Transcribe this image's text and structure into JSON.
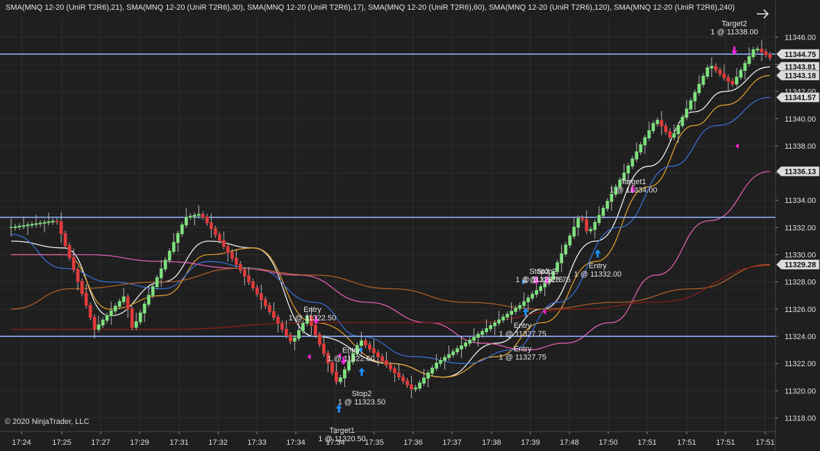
{
  "colors": {
    "background": "#1f1f1f",
    "grid": "#2e2e2e",
    "up_candle": "#7fe07f",
    "down_candle": "#e03c3c",
    "wick": "#bdbdbd",
    "hline": "#8fb1ff",
    "buy_arrow": "#1e90ff",
    "sell_arrow": "#ff22dd",
    "price_tag_bg": "#dcdcdc"
  },
  "header_text": "SMA(MNQ 12-20 (UniR T2R6),21), SMA(MNQ 12-20 (UniR T2R6),30), SMA(MNQ 12-20 (UniR T2R6),17), SMA(MNQ 12-20 (UniR T2R6),60), SMA(MNQ 12-20 (UniR T2R6),120), SMA(MNQ 12-20 (UniR T2R6),240)",
  "copyright": "© 2020 NinjaTrader, LLC",
  "nav_arrow_icon": "right-arrow-icon",
  "chart_data": {
    "type": "candlestick",
    "instrument": "MNQ 12-20 (UniR T2R6)",
    "ylim": [
      11317,
      11347.5
    ],
    "y_ticks": [
      "11318.00",
      "11320.00",
      "11322.00",
      "11324.00",
      "11326.00",
      "11328.00",
      "11330.00",
      "11332.00",
      "11334.00",
      "11336.00",
      "11338.00",
      "11340.00",
      "11342.00",
      "11344.00",
      "11346.00"
    ],
    "x_tick_labels": [
      "17:24",
      "17:25",
      "17:27",
      "17:29",
      "17:31",
      "17:32",
      "17:33",
      "17:34",
      "17:34",
      "17:35",
      "17:36",
      "17:37",
      "17:38",
      "17:39",
      "17:48",
      "17:50",
      "17:51",
      "17:51",
      "17:51",
      "17:51"
    ],
    "horizontal_lines": [
      11344.75,
      11332.75,
      11324.0
    ],
    "price_tags": [
      "11344.75",
      "11343.81",
      "11343.18",
      "11341.57",
      "11336.13",
      "11329.28"
    ],
    "price_tag_values": [
      11344.75,
      11343.81,
      11343.18,
      11341.57,
      11336.13,
      11329.28
    ],
    "close_path": [
      [
        0,
        11332.0
      ],
      [
        0.06,
        11332.5
      ],
      [
        0.11,
        11324.5
      ],
      [
        0.15,
        11327.0
      ],
      [
        0.16,
        11324.5
      ],
      [
        0.23,
        11332.75
      ],
      [
        0.25,
        11333.0
      ],
      [
        0.37,
        11323.5
      ],
      [
        0.39,
        11325.5
      ],
      [
        0.43,
        11320.5
      ],
      [
        0.46,
        11323.75
      ],
      [
        0.53,
        11320.0
      ],
      [
        0.56,
        11322.0
      ],
      [
        0.67,
        11326.25
      ],
      [
        0.71,
        11328.25
      ],
      [
        0.75,
        11333.0
      ],
      [
        0.76,
        11331.5
      ],
      [
        0.85,
        11340.0
      ],
      [
        0.87,
        11338.5
      ],
      [
        0.92,
        11344.0
      ],
      [
        0.95,
        11342.5
      ],
      [
        0.98,
        11345.25
      ],
      [
        1.0,
        11344.5
      ]
    ],
    "series": [
      {
        "name": "SMA(MNQ 12-20 (UniR T2R6),17)",
        "color": "#f5f5f5",
        "values": [
          [
            0,
            11331.0
          ],
          [
            0.07,
            11330.5
          ],
          [
            0.13,
            11325.5
          ],
          [
            0.2,
            11328.0
          ],
          [
            0.26,
            11331.0
          ],
          [
            0.32,
            11330.5
          ],
          [
            0.4,
            11324.0
          ],
          [
            0.5,
            11322.0
          ],
          [
            0.57,
            11321.0
          ],
          [
            0.64,
            11323.5
          ],
          [
            0.7,
            11326.0
          ],
          [
            0.77,
            11331.0
          ],
          [
            0.84,
            11336.5
          ],
          [
            0.9,
            11340.5
          ],
          [
            0.94,
            11342.0
          ],
          [
            1.0,
            11343.81
          ]
        ]
      },
      {
        "name": "SMA(MNQ 12-20 (UniR T2R6),21)",
        "color": "#e0a030",
        "values": [
          [
            0,
            11330.0
          ],
          [
            0.07,
            11330.0
          ],
          [
            0.13,
            11326.0
          ],
          [
            0.2,
            11327.0
          ],
          [
            0.26,
            11330.0
          ],
          [
            0.32,
            11330.5
          ],
          [
            0.4,
            11325.0
          ],
          [
            0.5,
            11322.0
          ],
          [
            0.57,
            11321.0
          ],
          [
            0.64,
            11322.5
          ],
          [
            0.7,
            11325.0
          ],
          [
            0.77,
            11329.5
          ],
          [
            0.84,
            11335.0
          ],
          [
            0.9,
            11339.5
          ],
          [
            0.94,
            11341.0
          ],
          [
            1.0,
            11343.18
          ]
        ]
      },
      {
        "name": "SMA(MNQ 12-20 (UniR T2R6),30)",
        "color": "#3b6fd6",
        "values": [
          [
            0,
            11331.5
          ],
          [
            0.07,
            11329.0
          ],
          [
            0.13,
            11328.0
          ],
          [
            0.2,
            11327.5
          ],
          [
            0.26,
            11329.5
          ],
          [
            0.32,
            11329.0
          ],
          [
            0.4,
            11326.5
          ],
          [
            0.46,
            11324.0
          ],
          [
            0.53,
            11322.5
          ],
          [
            0.6,
            11322.0
          ],
          [
            0.66,
            11323.0
          ],
          [
            0.72,
            11326.5
          ],
          [
            0.8,
            11332.0
          ],
          [
            0.87,
            11336.5
          ],
          [
            0.93,
            11339.5
          ],
          [
            1.0,
            11341.57
          ]
        ]
      },
      {
        "name": "SMA(MNQ 12-20 (UniR T2R6),60)",
        "color": "#e060b0",
        "values": [
          [
            0,
            11330.0
          ],
          [
            0.1,
            11330.0
          ],
          [
            0.2,
            11329.5
          ],
          [
            0.3,
            11329.0
          ],
          [
            0.38,
            11328.5
          ],
          [
            0.47,
            11326.5
          ],
          [
            0.55,
            11325.0
          ],
          [
            0.62,
            11323.5
          ],
          [
            0.68,
            11323.0
          ],
          [
            0.73,
            11323.5
          ],
          [
            0.79,
            11325.0
          ],
          [
            0.85,
            11328.5
          ],
          [
            0.92,
            11332.5
          ],
          [
            1.0,
            11336.13
          ]
        ]
      },
      {
        "name": "SMA(MNQ 12-20 (UniR T2R6),120)",
        "color": "#b0602a",
        "values": [
          [
            0,
            11326.0
          ],
          [
            0.08,
            11327.5
          ],
          [
            0.2,
            11328.0
          ],
          [
            0.3,
            11329.0
          ],
          [
            0.4,
            11328.5
          ],
          [
            0.5,
            11327.5
          ],
          [
            0.6,
            11326.5
          ],
          [
            0.7,
            11326.0
          ],
          [
            0.8,
            11326.5
          ],
          [
            0.9,
            11327.5
          ],
          [
            1.0,
            11329.28
          ]
        ]
      },
      {
        "name": "SMA(MNQ 12-20 (UniR T2R6),240)",
        "color": "#8a1c1c",
        "values": [
          [
            0,
            11324.5
          ],
          [
            0.2,
            11324.5
          ],
          [
            0.4,
            11325.0
          ],
          [
            0.6,
            11325.0
          ],
          [
            0.75,
            11326.0
          ],
          [
            0.85,
            11326.5
          ],
          [
            1.0,
            11329.2
          ]
        ]
      }
    ],
    "trade_markers": [
      {
        "t": 0.402,
        "price": 11325.0,
        "dir": "sell"
      },
      {
        "t": 0.432,
        "price": 11322.6,
        "dir": "sell_small"
      },
      {
        "t": 0.438,
        "price": 11322.0,
        "dir": "sell"
      },
      {
        "t": 0.462,
        "price": 11321.6,
        "dir": "buy"
      },
      {
        "t": 0.462,
        "price": 11323.0,
        "dir": "buy_small"
      },
      {
        "t": 0.432,
        "price": 11318.9,
        "dir": "buy"
      },
      {
        "t": 0.392,
        "price": 11322.5,
        "dir": "sell_small"
      },
      {
        "t": 0.676,
        "price": 11328.0,
        "dir": "buy_small"
      },
      {
        "t": 0.678,
        "price": 11326.0,
        "dir": "buy"
      },
      {
        "t": 0.692,
        "price": 11327.9,
        "dir": "sell"
      },
      {
        "t": 0.706,
        "price": 11327.9,
        "dir": "sell"
      },
      {
        "t": 0.702,
        "price": 11325.8,
        "dir": "sell_small"
      },
      {
        "t": 0.773,
        "price": 11330.3,
        "dir": "buy"
      },
      {
        "t": 0.819,
        "price": 11334.6,
        "dir": "sell"
      },
      {
        "t": 0.953,
        "price": 11344.8,
        "dir": "sell"
      },
      {
        "t": 0.956,
        "price": 11338.0,
        "dir": "sell_small"
      }
    ],
    "annotations": [
      {
        "label": "Entry",
        "sub": "1 @ 11322.50",
        "t": 0.397,
        "price": 11325.8
      },
      {
        "label": "Entry",
        "sub": "1 @ 11322.50",
        "t": 0.448,
        "price": 11322.8
      },
      {
        "label": "Stop2",
        "sub": "1 @ 11323.50",
        "t": 0.462,
        "price": 11319.6
      },
      {
        "label": "Target1",
        "sub": "1 @ 11320.50",
        "t": 0.436,
        "price": 11316.9
      },
      {
        "label": "Stop2",
        "sub": "1 @ 11325.75",
        "t": 0.696,
        "price": 11328.6
      },
      {
        "label": "Stop2",
        "sub": "1 @ 11325.75",
        "t": 0.706,
        "price": 11328.6
      },
      {
        "label": "Entry",
        "sub": "1 @ 11327.75",
        "t": 0.674,
        "price": 11324.6
      },
      {
        "label": "Entry",
        "sub": "1 @ 11327.75",
        "t": 0.674,
        "price": 11322.9
      },
      {
        "label": "Entry",
        "sub": "1 @ 11332.00",
        "t": 0.773,
        "price": 11329.0
      },
      {
        "label": "Target1",
        "sub": "1 @ 11334.00",
        "t": 0.82,
        "price": 11335.2
      },
      {
        "label": "Target2",
        "sub": "1 @ 11338.00",
        "t": 0.953,
        "price": 11346.8
      }
    ]
  }
}
